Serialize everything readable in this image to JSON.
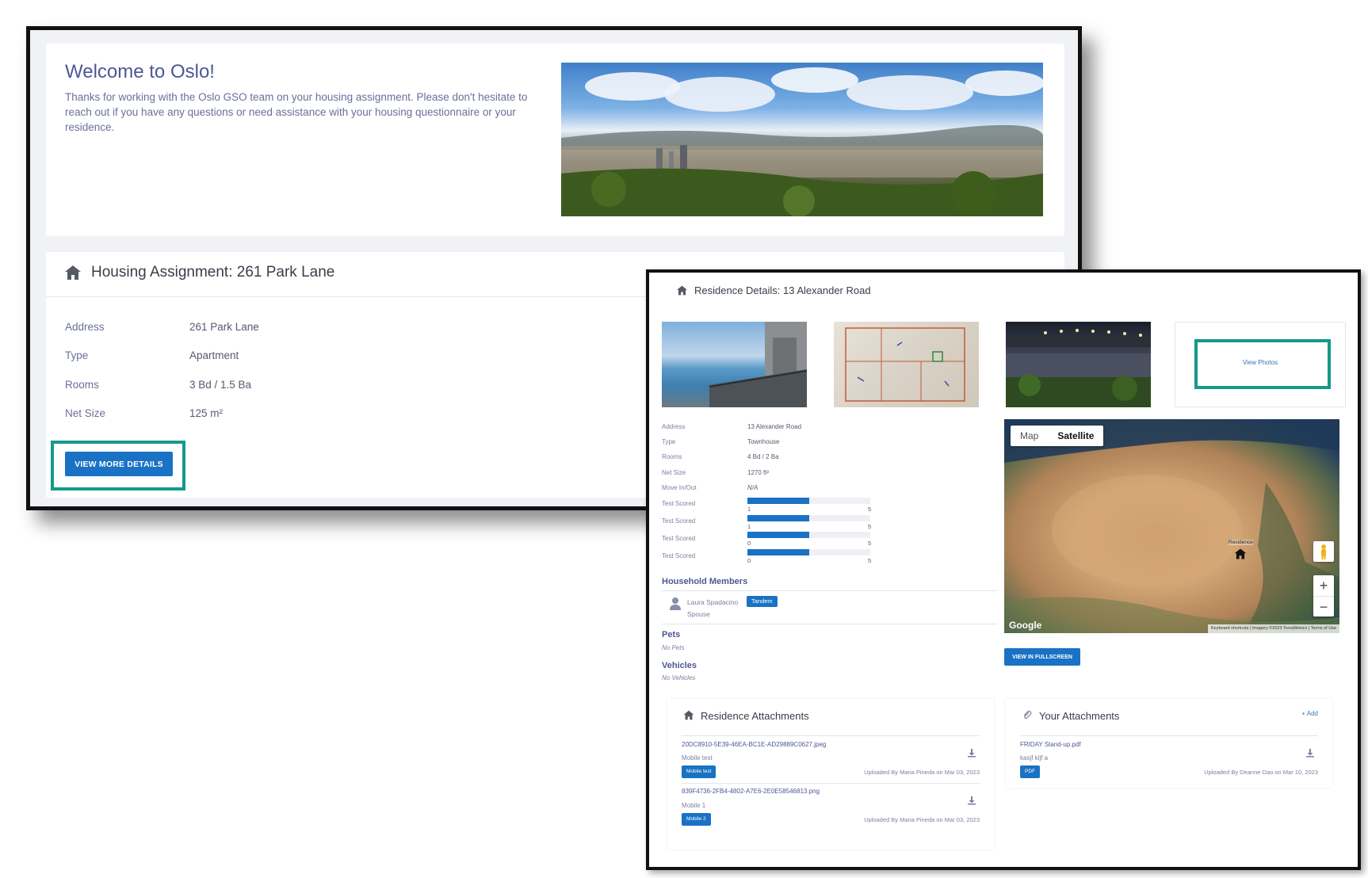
{
  "welcome": {
    "title": "Welcome to Oslo!",
    "text": "Thanks for working with the Oslo GSO team on your housing assignment.  Please don't hesitate to reach out if you have any questions or need assistance with your housing questionnaire or your residence."
  },
  "housing": {
    "title": "Housing Assignment: 261 Park Lane",
    "rows": [
      {
        "label": "Address",
        "value": "261 Park Lane"
      },
      {
        "label": "Type",
        "value": "Apartment"
      },
      {
        "label": "Rooms",
        "value": "3 Bd / 1.5 Ba"
      },
      {
        "label": "Net Size",
        "value": "125 m²"
      }
    ],
    "more_button": "VIEW MORE DETAILS"
  },
  "residence": {
    "title": "Residence Details: 13 Alexander Road",
    "view_photos": "View Photos",
    "rows": [
      {
        "label": "Address",
        "value": "13 Alexander Road"
      },
      {
        "label": "Type",
        "value": "Townhouse"
      },
      {
        "label": "Rooms",
        "value": "4 Bd / 2 Ba"
      },
      {
        "label": "Net Size",
        "value": "1270 ft²"
      },
      {
        "label": "Move In/Out",
        "value": "N/A"
      }
    ],
    "scores": [
      {
        "label": "Test Scored",
        "min": "1",
        "max": "5",
        "fill": 0.5
      },
      {
        "label": "Test Scored",
        "min": "1",
        "max": "5",
        "fill": 0.5
      },
      {
        "label": "Test Scored",
        "min": "0",
        "max": "5",
        "fill": 0.5
      },
      {
        "label": "Test Scored",
        "min": "0",
        "max": "5",
        "fill": 0.5
      }
    ],
    "household_heading": "Household Members",
    "member": {
      "name": "Laura Spadacino",
      "role": "Spouse",
      "badge": "Tandem"
    },
    "pets_heading": "Pets",
    "pets_value": "No Pets",
    "vehicles_heading": "Vehicles",
    "vehicles_value": "No Vehicles"
  },
  "map": {
    "tab_map": "Map",
    "tab_satellite": "Satellite",
    "zoom_in": "+",
    "zoom_out": "−",
    "google": "Google",
    "attribution": "Keyboard shortcuts | Imagery ©2023 TerraMetrics | Terms of Use",
    "marker_label": "Residence",
    "fullscreen_button": "VIEW IN FULLSCREEN"
  },
  "residence_attachments": {
    "title": "Residence Attachments",
    "files": [
      {
        "name": "20DC8910-5E39-46EA-BC1E-AD29889C0627.jpeg",
        "desc": "Mobile test",
        "badge": "Mobile test",
        "meta": "Uploaded By Maria Pineda on Mar 03, 2023"
      },
      {
        "name": "839F4736-2FB4-4802-A7E6-2E0E58546813.png",
        "desc": "Mobile 1",
        "badge": "Mobile 2",
        "meta": "Uploaded By Maria Pineda on Mar 03, 2023"
      }
    ]
  },
  "your_attachments": {
    "title": "Your Attachments",
    "add": "+ Add",
    "files": [
      {
        "name": "FRIDAY Stand-up.pdf",
        "desc": "kasjf kljf a",
        "badge": "PDF",
        "meta": "Uploaded By Deanne Dao on Mar 10, 2023"
      }
    ]
  },
  "colors": {
    "primary": "#1a72c4",
    "highlight": "#15998a",
    "title": "#4e5794"
  }
}
